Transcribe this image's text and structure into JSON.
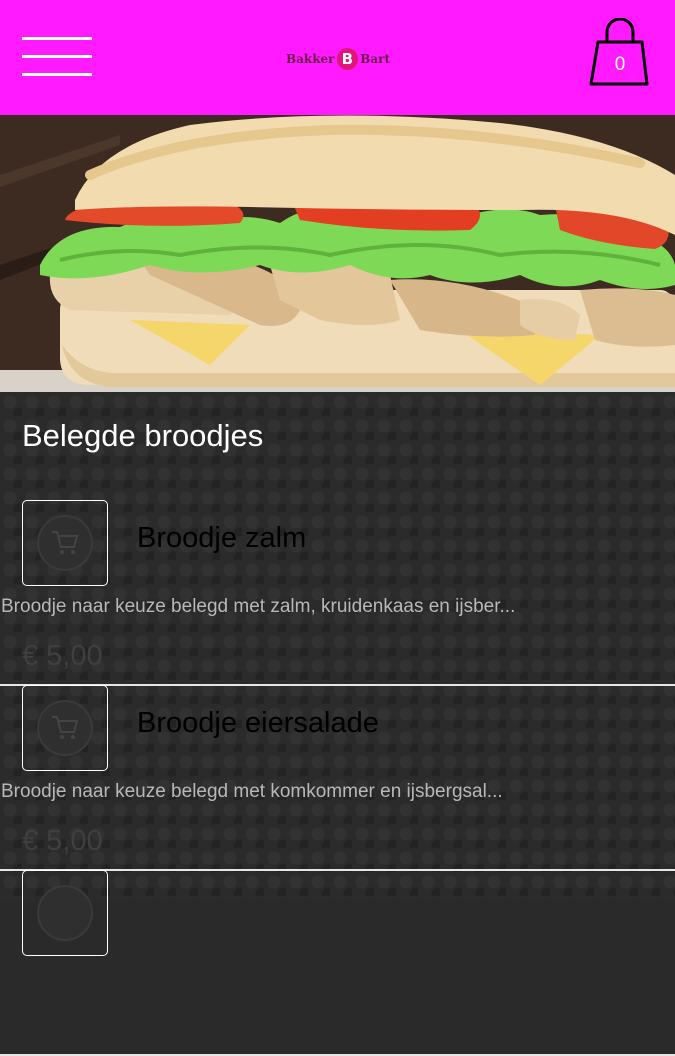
{
  "header": {
    "logo_left": "Bakker",
    "logo_badge": "B",
    "logo_right": "Bart",
    "cart_count": "0"
  },
  "hero": {
    "image": "sandwich-photo"
  },
  "category": {
    "title": "Belegde broodjes"
  },
  "products": [
    {
      "name": "Broodje zalm",
      "description": "Broodje naar keuze belegd met zalm, kruidenkaas en ijsber...",
      "price": "€ 5,00"
    },
    {
      "name": "Broodje eiersalade",
      "description": "Broodje naar keuze belegd met komkommer en ijsbergsal...",
      "price": "€ 5,00"
    },
    {
      "name": "",
      "description": "",
      "price": ""
    }
  ],
  "colors": {
    "header_bg": "#ff1aff",
    "content_bg": "#2b2b2b",
    "divider": "#e6e6e6"
  }
}
